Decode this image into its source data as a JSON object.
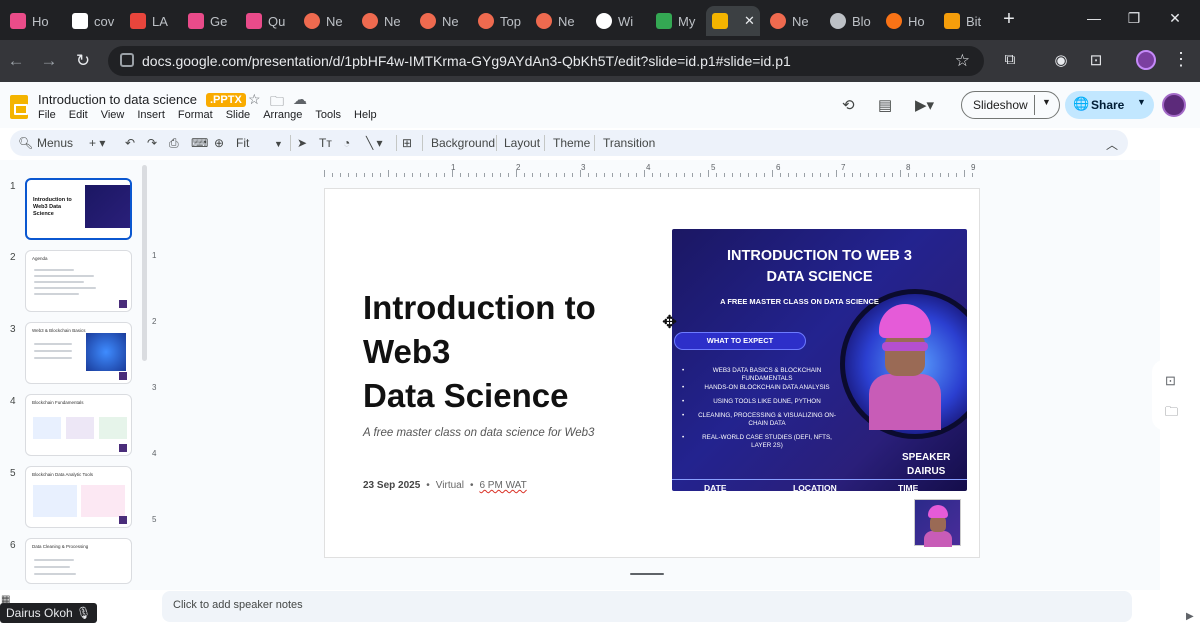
{
  "browser": {
    "tabs": [
      {
        "label": "Ho",
        "color": "#ea4c89"
      },
      {
        "label": "cov",
        "color": "#ffffff"
      },
      {
        "label": "LA",
        "color": "#e8453c"
      },
      {
        "label": "Ge",
        "color": "#e94b8a"
      },
      {
        "label": "Qu",
        "color": "#e94b8a"
      },
      {
        "label": "Ne",
        "color": "#ee6a4f"
      },
      {
        "label": "Ne",
        "color": "#ee6a4f"
      },
      {
        "label": "Ne",
        "color": "#ee6a4f"
      },
      {
        "label": "Top",
        "color": "#ee6a4f"
      },
      {
        "label": "Ne",
        "color": "#ee6a4f"
      },
      {
        "label": "Wi",
        "color": "#ffffff"
      },
      {
        "label": "My",
        "color": "#34a853"
      },
      {
        "label": "",
        "color": "#f4b400"
      },
      {
        "label": "Ne",
        "color": "#ee6a4f"
      },
      {
        "label": "Blo",
        "color": "#bdc1c6"
      },
      {
        "label": "Ho",
        "color": "#f97316"
      },
      {
        "label": "Bit",
        "color": "#f59e0b"
      }
    ],
    "url": "docs.google.com/presentation/d/1pbHF4w-IMTKrma-GYg9AYdAn3-QbKh5T/edit?slide=id.p1#slide=id.p1"
  },
  "doc": {
    "title": "Introduction to data science",
    "badge": ".PPTX",
    "menu": [
      "File",
      "Edit",
      "View",
      "Insert",
      "Format",
      "Slide",
      "Arrange",
      "Tools",
      "Help"
    ],
    "slideshow_label": "Slideshow",
    "share_label": "Share"
  },
  "toolbar": {
    "menus_label": "Menus",
    "zoom_label": "Fit",
    "background": "Background",
    "layout": "Layout",
    "theme": "Theme",
    "transition": "Transition"
  },
  "filmstrip": {
    "slides": [
      {
        "num": "1",
        "title": "Introduction to Web3 Data Science"
      },
      {
        "num": "2",
        "title": "Agenda"
      },
      {
        "num": "3",
        "title": "Web3 & Blockchain Basics"
      },
      {
        "num": "4",
        "title": "Blockchain Fundamentals"
      },
      {
        "num": "5",
        "title": "Blockchain Data Analytic Tools"
      },
      {
        "num": "6",
        "title": "Data Cleaning & Processing"
      }
    ]
  },
  "ruler": {
    "h": [
      "1",
      "2",
      "3",
      "4",
      "5",
      "6",
      "7",
      "8",
      "9"
    ],
    "v": [
      "1",
      "2",
      "3",
      "4",
      "5"
    ]
  },
  "slide": {
    "title_lines": [
      "Introduction to",
      "Web3",
      "Data Science"
    ],
    "subtitle": "A free master class on data science for Web3",
    "date": "23 Sep 2025",
    "sep": "•",
    "mode": "Virtual",
    "time": "6 PM WAT",
    "poster": {
      "title_lines": [
        "INTRODUCTION TO WEB 3",
        "DATA SCIENCE"
      ],
      "subtitle": "A FREE MASTER CLASS ON DATA SCIENCE",
      "expect": "WHAT TO EXPECT",
      "items": [
        "WEB3 DATA BASICS & BLOCKCHAIN FUNDAMENTALS",
        "HANDS-ON BLOCKCHAIN DATA ANALYSIS",
        "USING TOOLS LIKE DUNE, PYTHON",
        "CLEANING, PROCESSING & VISUALIZING ON-CHAIN DATA",
        "REAL-WORLD CASE STUDIES (DEFI, NFTS, LAYER 2S)"
      ],
      "speaker_label": "SPEAKER",
      "speaker_name": "DAIRUS",
      "footer": [
        "DATE",
        "LOCATION",
        "TIME"
      ]
    }
  },
  "notes_placeholder": "Click to add speaker notes",
  "presenter_name": "Dairus Okoh"
}
